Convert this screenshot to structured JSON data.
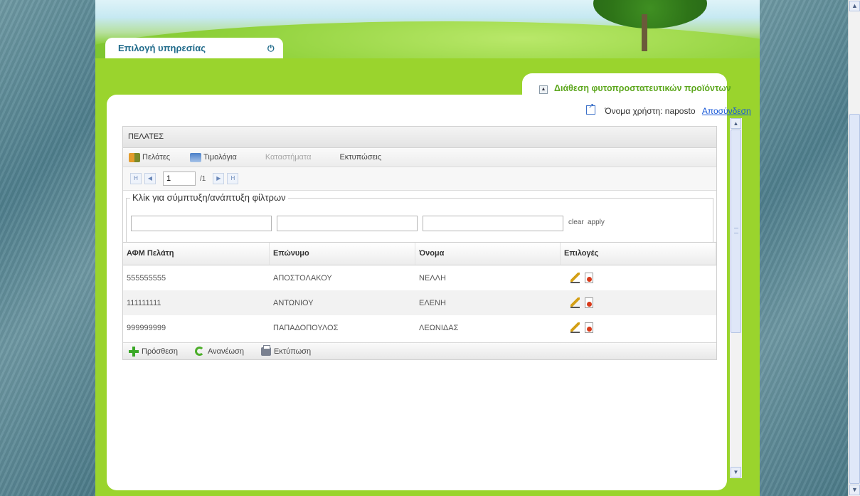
{
  "header": {
    "service_tab_label": "Επιλογή υπηρεσίας",
    "service_power_glyph": "⏻",
    "module_title": "Διάθεση φυτοπροστατευτικών προϊόντων",
    "user_label": "Όνομα χρήστη: naposto",
    "logout_link": "Αποσύνδεση"
  },
  "panel": {
    "title": "ΠΕΛΑΤΕΣ",
    "toolbar": [
      {
        "label": "Πελάτες",
        "icon": "customers-icon",
        "enabled": true
      },
      {
        "label": "Τιμολόγια",
        "icon": "invoices-icon",
        "enabled": true
      },
      {
        "label": "Καταστήματα",
        "icon": "",
        "enabled": false
      },
      {
        "label": "Εκτυπώσεις",
        "icon": "",
        "enabled": true
      }
    ],
    "pager": {
      "page_value": "1",
      "total_pages": "/1",
      "first_glyph": "H",
      "prev_glyph": "◀",
      "next_glyph": "▶",
      "last_glyph": "H"
    },
    "filters": {
      "legend": "Κλίκ για σύμπτυξη/ανάπτυξη φίλτρων",
      "field1_value": "",
      "field2_value": "",
      "field3_value": "",
      "clear_label": "clear",
      "apply_label": "apply"
    },
    "grid": {
      "columns": [
        "ΑΦΜ Πελάτη",
        "Επώνυμο",
        "Όνομα",
        "Επιλογές"
      ],
      "rows": [
        {
          "afm": "555555555",
          "surname": "ΑΠΟΣΤΟΛΑΚΟΥ",
          "name": "ΝΕΛΛΗ"
        },
        {
          "afm": "111111111",
          "surname": "ΑΝΤΩΝΙΟΥ",
          "name": "ΕΛΕΝΗ"
        },
        {
          "afm": "999999999",
          "surname": "ΠΑΠΑΔΟΠΟΥΛΟΣ",
          "name": "ΛΕΩΝΙΔΑΣ"
        }
      ]
    },
    "bottom_toolbar": {
      "add_label": "Πρόσθεση",
      "refresh_label": "Ανανέωση",
      "print_label": "Εκτύπωση"
    }
  },
  "colors": {
    "page_green": "#9ad42d",
    "title_blue": "#1f6a8a",
    "module_green": "#5da71e",
    "link_blue": "#1858d8"
  }
}
